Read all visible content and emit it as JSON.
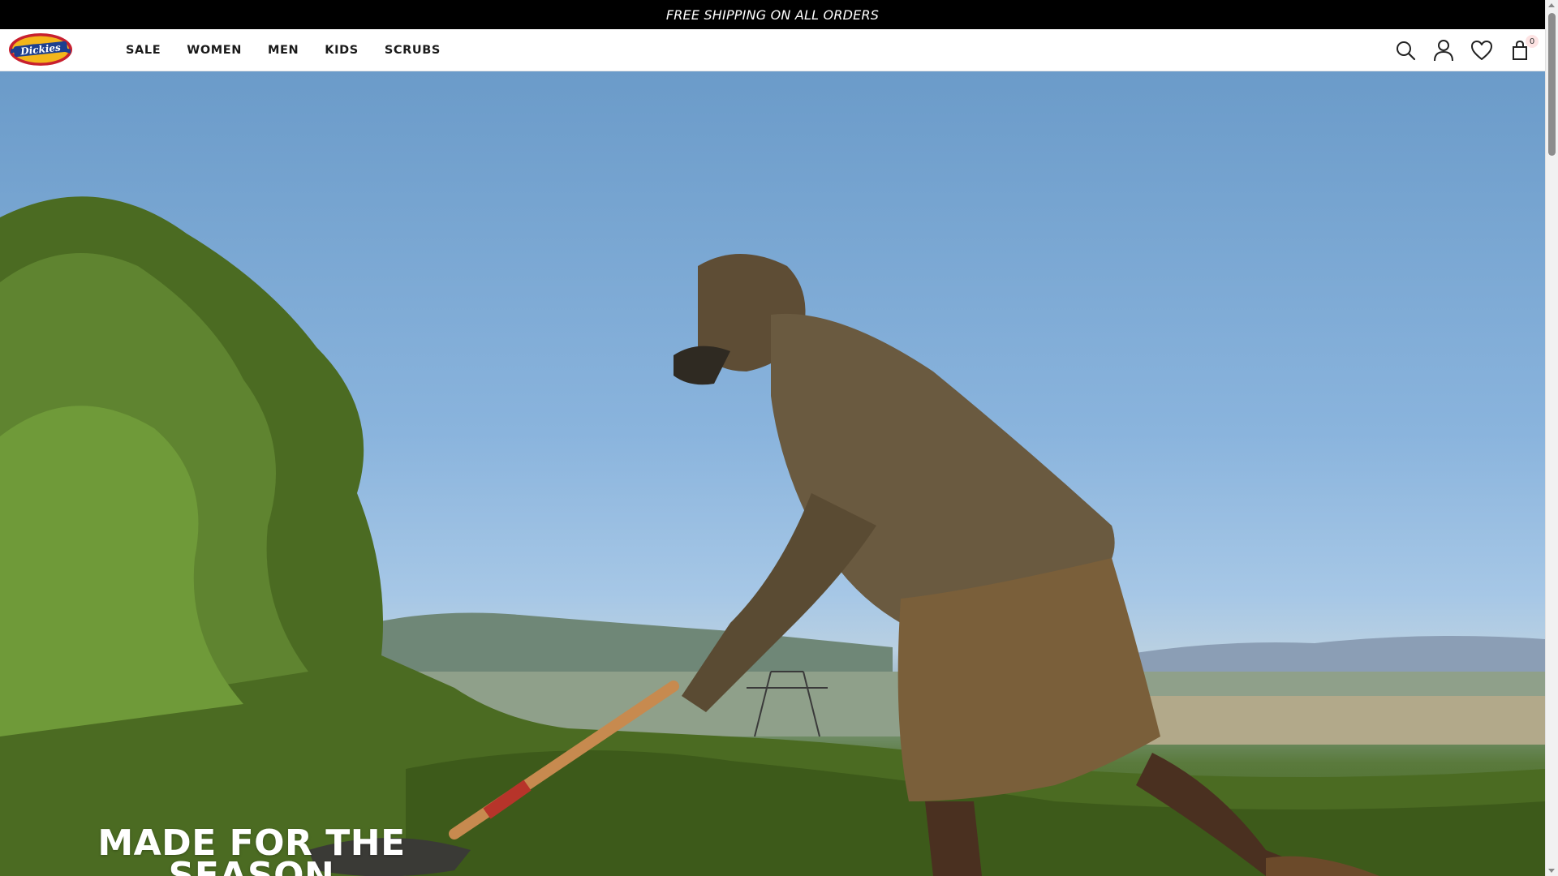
{
  "promo": {
    "text": "FREE SHIPPING ON ALL ORDERS"
  },
  "header": {
    "logo_text": "Dickies",
    "nav": [
      {
        "label": "SALE"
      },
      {
        "label": "WOMEN"
      },
      {
        "label": "MEN"
      },
      {
        "label": "KIDS"
      },
      {
        "label": "SCRUBS"
      }
    ],
    "icons": [
      "search-icon",
      "account-icon",
      "wishlist-heart-icon",
      "cart-bag-icon"
    ],
    "cart_count": "0"
  },
  "hero": {
    "headline_line1": "MADE FOR THE",
    "headline_line2": "SEASON"
  },
  "colors": {
    "promo_bg": "#000000",
    "logo_red": "#c8202f",
    "logo_blue": "#1d3f8f",
    "logo_yellow": "#f3b61b",
    "badge_bg": "#fde3e3"
  }
}
